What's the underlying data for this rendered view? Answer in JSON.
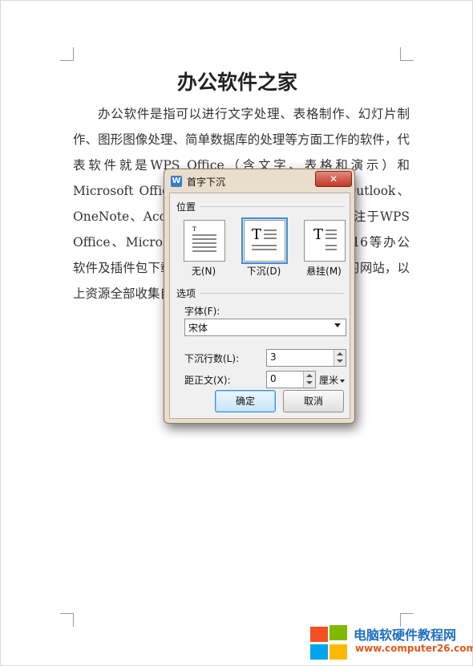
{
  "document": {
    "title": "办公软件之家",
    "body": "办公软件是指可以进行文字处理、表格制作、幻灯片制作、图形图像处理、简单数据库的处理等方面工作的软件，代表软件就是WPS Office（含文字、表格和演示）和Microsoft Office（含Word、Excel、PPT、Outlook、OneNote、Access等）。办公软件之家是一个专注于WPS Office、Microsoft Office2007/2010/2013/2016等办公软件及插件包下载、使用技巧和教程的办公软件学习网站，以上资源全部收集自互联网。"
  },
  "dialog": {
    "title": "首字下沉",
    "close_label": "✕",
    "position_group": "位置",
    "positions": [
      {
        "label": "无(N)",
        "icon": "dropcap-none-icon"
      },
      {
        "label": "下沉(D)",
        "icon": "dropcap-dropped-icon",
        "selected": true
      },
      {
        "label": "悬挂(M)",
        "icon": "dropcap-margin-icon"
      }
    ],
    "options_group": "选项",
    "font_label": "字体(F):",
    "font_value": "宋体",
    "lines_label": "下沉行数(L):",
    "lines_value": "3",
    "distance_label": "距正文(X):",
    "distance_value": "0",
    "distance_unit": "厘米",
    "ok_label": "确定",
    "cancel_label": "取消"
  },
  "watermark": {
    "name": "电脑软硬件教程网",
    "url": "www.computer26.com",
    "logo_colors": [
      "#f25022",
      "#7fba00",
      "#00a4ef",
      "#ffb900"
    ]
  }
}
